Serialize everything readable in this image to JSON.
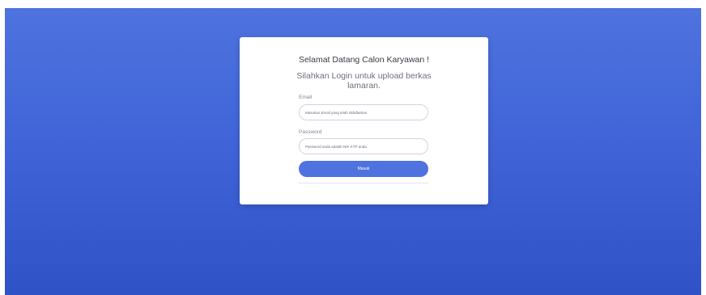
{
  "login": {
    "title": "Selamat Datang Calon Karyawan !",
    "subtitle": "Silahkan Login untuk upload berkas lamaran.",
    "email_label": "Email",
    "email_placeholder": "Masukan Email yang telah didaftarkan",
    "email_value": "",
    "password_label": "Password",
    "password_placeholder": "Password anda adalah NIK KTP anda",
    "password_value": "",
    "submit_label": "Masuk"
  },
  "colors": {
    "background_top": "#4e73df",
    "background_bottom": "#2f52c7",
    "primary": "#4e73df",
    "card": "#ffffff"
  }
}
